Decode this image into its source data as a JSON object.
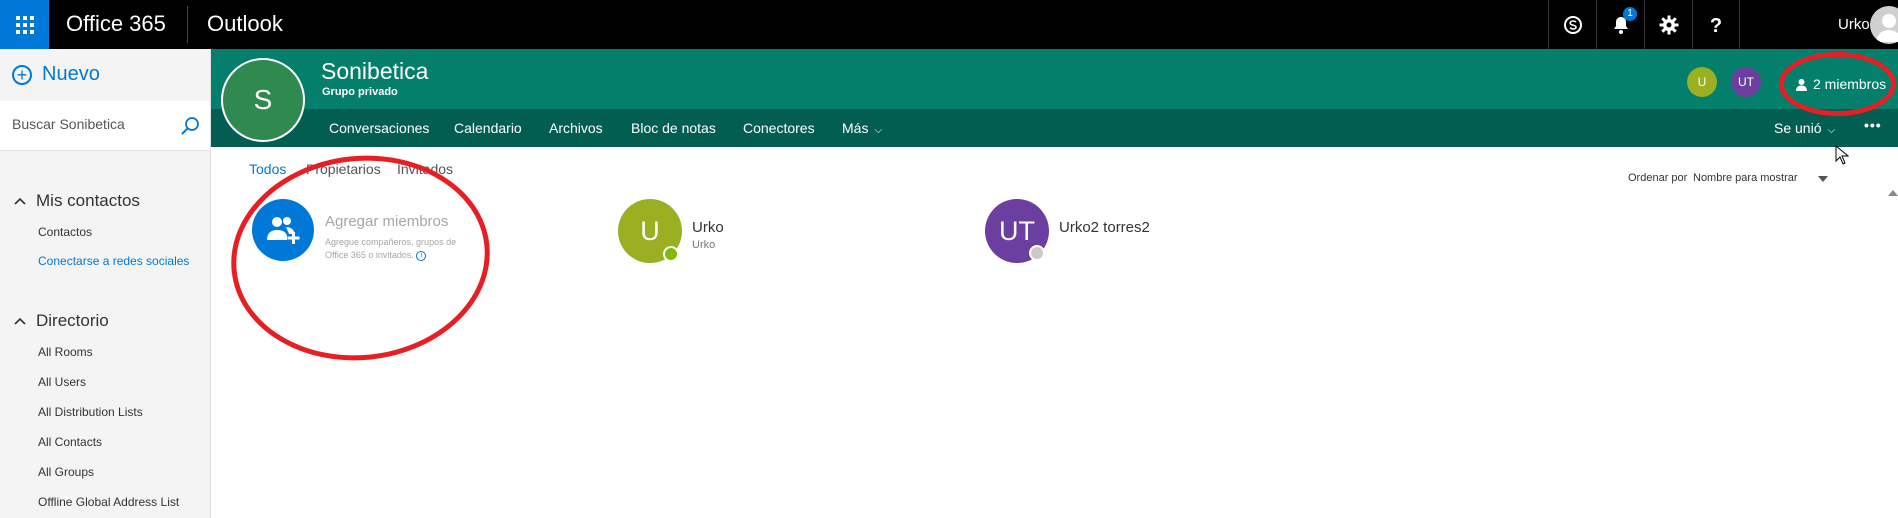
{
  "topbar": {
    "brand": "Office 365",
    "app": "Outlook",
    "notification_count": "1",
    "user_name": "Urko",
    "icons": [
      "waffle-icon",
      "skype-icon",
      "bell-icon",
      "gear-icon",
      "help-icon"
    ]
  },
  "leftnav": {
    "new_label": "Nuevo",
    "search_placeholder": "Buscar Sonibetica",
    "my_contacts": {
      "title": "Mis contactos",
      "items": [
        "Contactos",
        "Conectarse a redes sociales"
      ]
    },
    "directory": {
      "title": "Directorio",
      "items": [
        "All Rooms",
        "All Users",
        "All Distribution Lists",
        "All Contacts",
        "All Groups",
        "Offline Global Address List"
      ]
    }
  },
  "group": {
    "initial": "S",
    "name": "Sonibetica",
    "type": "Grupo privado",
    "member_initials": [
      "U",
      "UT"
    ],
    "members_label": "2 miembros",
    "nav": [
      "Conversaciones",
      "Calendario",
      "Archivos",
      "Bloc de notas",
      "Conectores",
      "Más"
    ],
    "joined_label": "Se unió",
    "more_label": "•••"
  },
  "filters": {
    "tabs": [
      "Todos",
      "Propietarios",
      "Invitados"
    ],
    "active": "Todos",
    "sort_label": "Ordenar por",
    "sort_value": "Nombre para mostrar"
  },
  "add_members": {
    "title": "Agregar miembros",
    "description": "Agregue compañeros, grupos de Office 365 o invitados."
  },
  "members": [
    {
      "initials": "U",
      "name": "Urko",
      "subtitle": "Urko",
      "color": "#9aaf22",
      "presence": "#7fba00"
    },
    {
      "initials": "UT",
      "name": "Urko2 torres2",
      "subtitle": "",
      "color": "#6b3fa0",
      "presence": "#c8c8c8"
    }
  ],
  "colors": {
    "accent": "#0078d7",
    "group_header": "#037f6b",
    "group_nav": "#035e52",
    "annotation": "#e81e25"
  }
}
